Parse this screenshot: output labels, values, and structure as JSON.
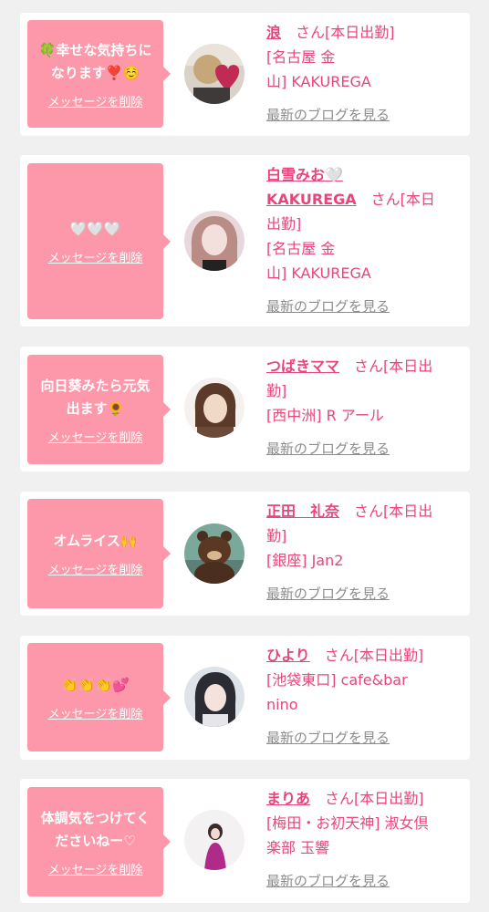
{
  "delete_label": "メッセージを削除",
  "blog_label": "最新のブログを見る",
  "items": [
    {
      "message": "🍀幸せな気持ちに\nなります❣️☺️",
      "name": "浪",
      "suffix": "　さん[本日出勤]",
      "shop": "[名古屋 金\n山] KAKUREGA"
    },
    {
      "message": "🤍🤍🤍",
      "name": "白雪みお🤍\nKAKUREGA",
      "suffix": "　さん[本日\n出勤]",
      "shop": "[名古屋 金\n山] KAKUREGA"
    },
    {
      "message": "向日葵みたら元気\n出ます🌻",
      "name": "つばきママ",
      "suffix": "　さん[本日出\n勤]",
      "shop": "[西中洲] R アール"
    },
    {
      "message": "オムライス🙌",
      "name": "正田　礼奈",
      "suffix": "　さん[本日出\n勤]",
      "shop": "[銀座] Jan2"
    },
    {
      "message": "👏👏👏💕",
      "name": "ひより",
      "suffix": "　さん[本日出勤]",
      "shop": "[池袋東口] cafe&bar\nnino"
    },
    {
      "message": "体調気をつけてく\nださいねー♡",
      "name": "まりあ",
      "suffix": "　さん[本日出勤]",
      "shop": "[梅田・お初天神] 淑女倶\n楽部 玉響"
    }
  ]
}
